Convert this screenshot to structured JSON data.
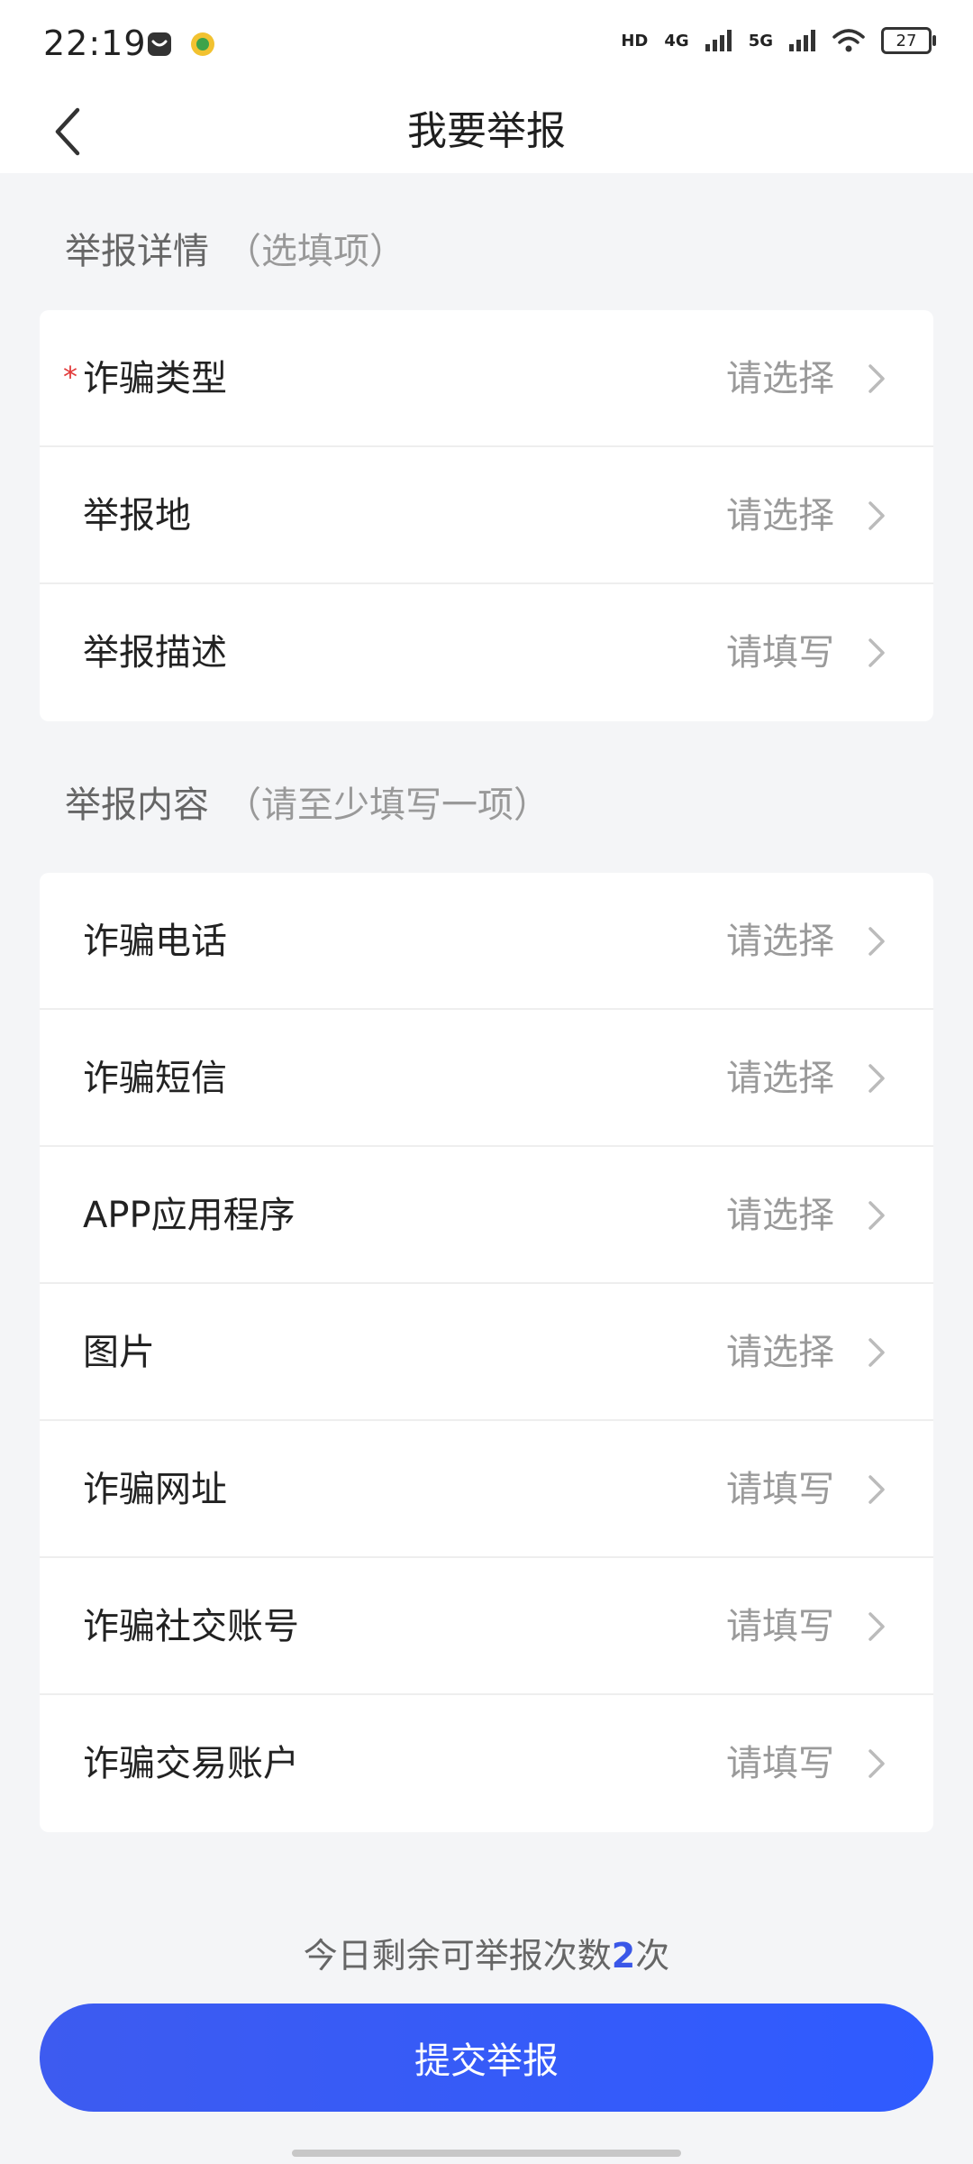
{
  "status": {
    "time": "22:19",
    "battery": "27",
    "network_1": "4G",
    "network_2": "5G",
    "hd": "HD"
  },
  "nav": {
    "title": "我要举报"
  },
  "section1": {
    "title": "举报详情",
    "hint": "（选填项）",
    "rows": [
      {
        "label": "诈骗类型",
        "value": "请选择",
        "required": true
      },
      {
        "label": "举报地",
        "value": "请选择"
      },
      {
        "label": "举报描述",
        "value": "请填写"
      }
    ]
  },
  "section2": {
    "title": "举报内容",
    "hint": "（请至少填写一项）",
    "rows": [
      {
        "label": "诈骗电话",
        "value": "请选择"
      },
      {
        "label": "诈骗短信",
        "value": "请选择"
      },
      {
        "label": "APP应用程序",
        "value": "请选择"
      },
      {
        "label": "图片",
        "value": "请选择"
      },
      {
        "label": "诈骗网址",
        "value": "请填写"
      },
      {
        "label": "诈骗社交账号",
        "value": "请填写"
      },
      {
        "label": "诈骗交易账户",
        "value": "请填写"
      }
    ]
  },
  "footer": {
    "remain_prefix": "今日剩余可举报次数",
    "remain_count": "2",
    "remain_suffix": "次",
    "submit_label": "提交举报"
  },
  "colors": {
    "accent": "#3a57e8",
    "required": "#e23b3b"
  }
}
